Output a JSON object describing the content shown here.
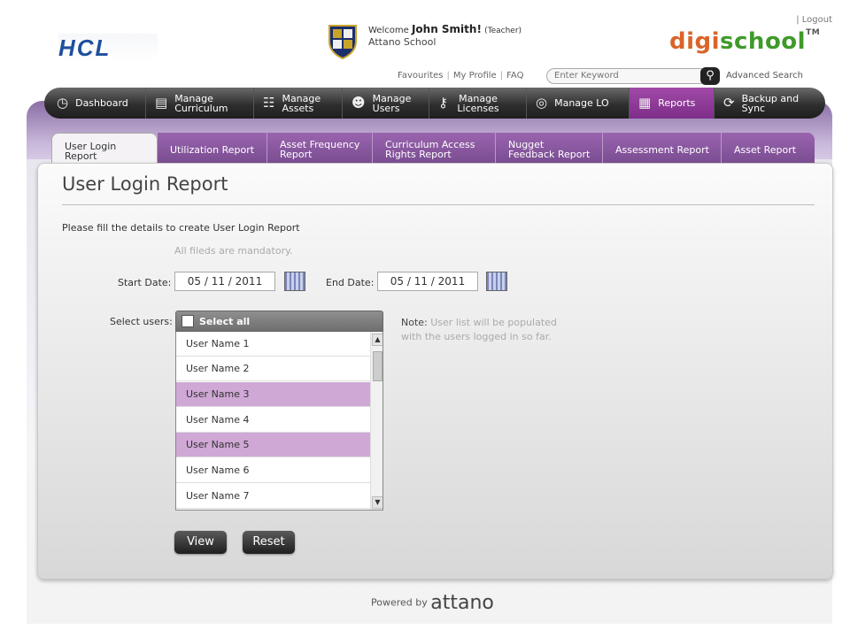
{
  "header": {
    "hcl_logo": "HCL",
    "welcome_prefix": "Welcome",
    "user_name": "John Smith!",
    "user_role": "(Teacher)",
    "school": "Attano School",
    "logout": "| Logout",
    "brand_part1": "digi",
    "brand_part2": "school",
    "brand_tm": "TM",
    "links": {
      "favourites": "Favourites",
      "profile": "My Profile",
      "faq": "FAQ"
    },
    "search_placeholder": "Enter Keyword",
    "advanced_search": "Advanced Search"
  },
  "nav": {
    "items": [
      {
        "label": "Dashboard",
        "icon": "dashboard-icon"
      },
      {
        "label": "Manage Curriculum",
        "icon": "curriculum-icon"
      },
      {
        "label": "Manage Assets",
        "icon": "assets-icon"
      },
      {
        "label": "Manage Users",
        "icon": "users-icon"
      },
      {
        "label": "Manage Licenses",
        "icon": "key-icon"
      },
      {
        "label": "Manage LO",
        "icon": "target-icon"
      },
      {
        "label": "Reports",
        "icon": "clipboard-icon",
        "active": true
      },
      {
        "label": "Backup and Sync",
        "icon": "sync-icon"
      }
    ]
  },
  "subtabs": [
    {
      "label": "User Login Report",
      "active": true
    },
    {
      "label": "Utilization Report"
    },
    {
      "label": "Asset Frequency Report"
    },
    {
      "label": "Curriculum Access Rights Report"
    },
    {
      "label": "Nugget Feedback Report"
    },
    {
      "label": "Assessment Report"
    },
    {
      "label": "Asset Report"
    }
  ],
  "form": {
    "title": "User Login Report",
    "instruction": "Please fill the details to create User Login Report",
    "mandatory": "All fileds are mandatory.",
    "start_label": "Start Date:",
    "start_value": "05 / 11 / 2011",
    "end_label": "End Date:",
    "end_value": "05 / 11 / 2011",
    "select_users_label": "Select users:",
    "select_all": "Select all",
    "users": [
      {
        "name": "User Name 1",
        "selected": false
      },
      {
        "name": "User Name 2",
        "selected": false
      },
      {
        "name": "User Name 3",
        "selected": true
      },
      {
        "name": "User Name 4",
        "selected": false
      },
      {
        "name": "User Name 5",
        "selected": true
      },
      {
        "name": "User Name 6",
        "selected": false
      },
      {
        "name": "User Name 7",
        "selected": false
      }
    ],
    "note_label": "Note:",
    "note_line1": "User list will be populated",
    "note_line2": "with the users logged in so far.",
    "view_button": "View",
    "reset_button": "Reset"
  },
  "footer": {
    "powered_by": "Powered by",
    "brand": "attano"
  },
  "colors": {
    "accent": "#8a4a9e",
    "selected_row": "#cfa8d6",
    "nav_dark": "#2f2f2f"
  }
}
